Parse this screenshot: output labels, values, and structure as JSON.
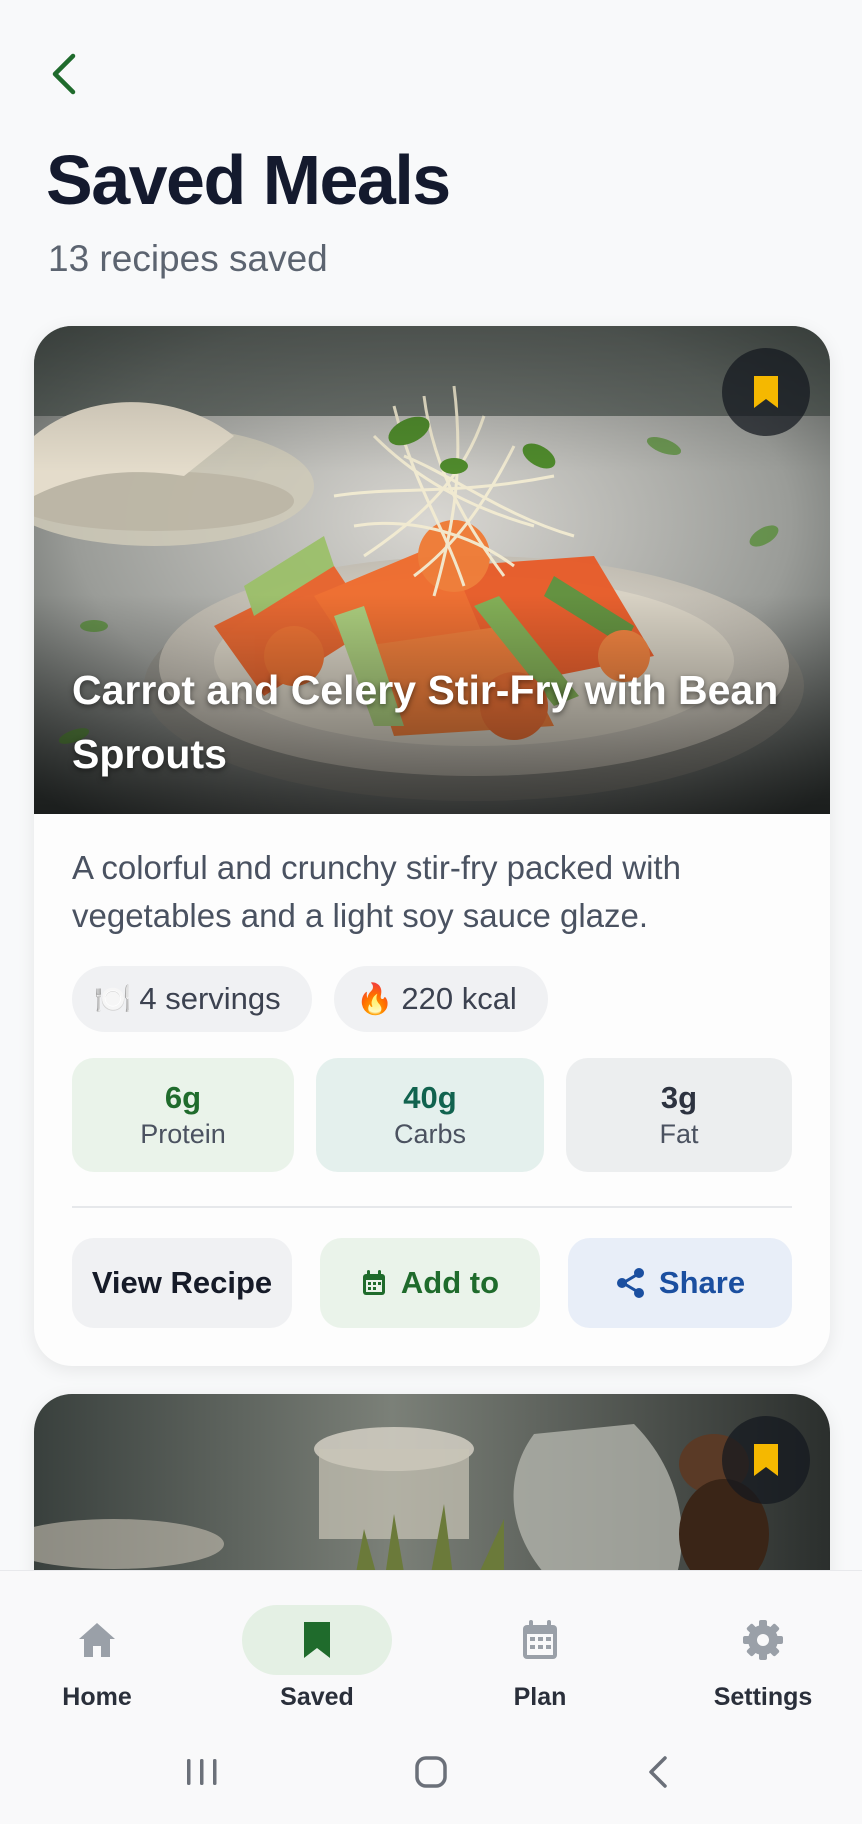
{
  "header": {
    "title": "Saved Meals",
    "subtitle": "13 recipes saved"
  },
  "recipes": [
    {
      "title": "Carrot and Celery Stir-Fry with Bean Sprouts",
      "description": "A colorful and crunchy stir-fry packed with vegetables and a light soy sauce glaze.",
      "servings": "4 servings",
      "calories": "220 kcal",
      "macros": {
        "protein": {
          "value": "6g",
          "label": "Protein"
        },
        "carbs": {
          "value": "40g",
          "label": "Carbs"
        },
        "fat": {
          "value": "3g",
          "label": "Fat"
        }
      },
      "actions": {
        "view": "View Recipe",
        "add": "Add to",
        "share": "Share"
      },
      "bookmarked": true
    },
    {
      "bookmarked": true
    }
  ],
  "icons": {
    "servings": "🍽️",
    "calories": "🔥"
  },
  "bottom_nav": [
    {
      "label": "Home",
      "icon": "home-icon"
    },
    {
      "label": "Saved",
      "icon": "bookmark-icon",
      "active": true
    },
    {
      "label": "Plan",
      "icon": "calendar-icon"
    },
    {
      "label": "Settings",
      "icon": "gear-icon"
    }
  ],
  "colors": {
    "accent_green": "#1f6b2c",
    "bookmark_yellow": "#f5b800",
    "share_blue": "#1b4fa0"
  }
}
